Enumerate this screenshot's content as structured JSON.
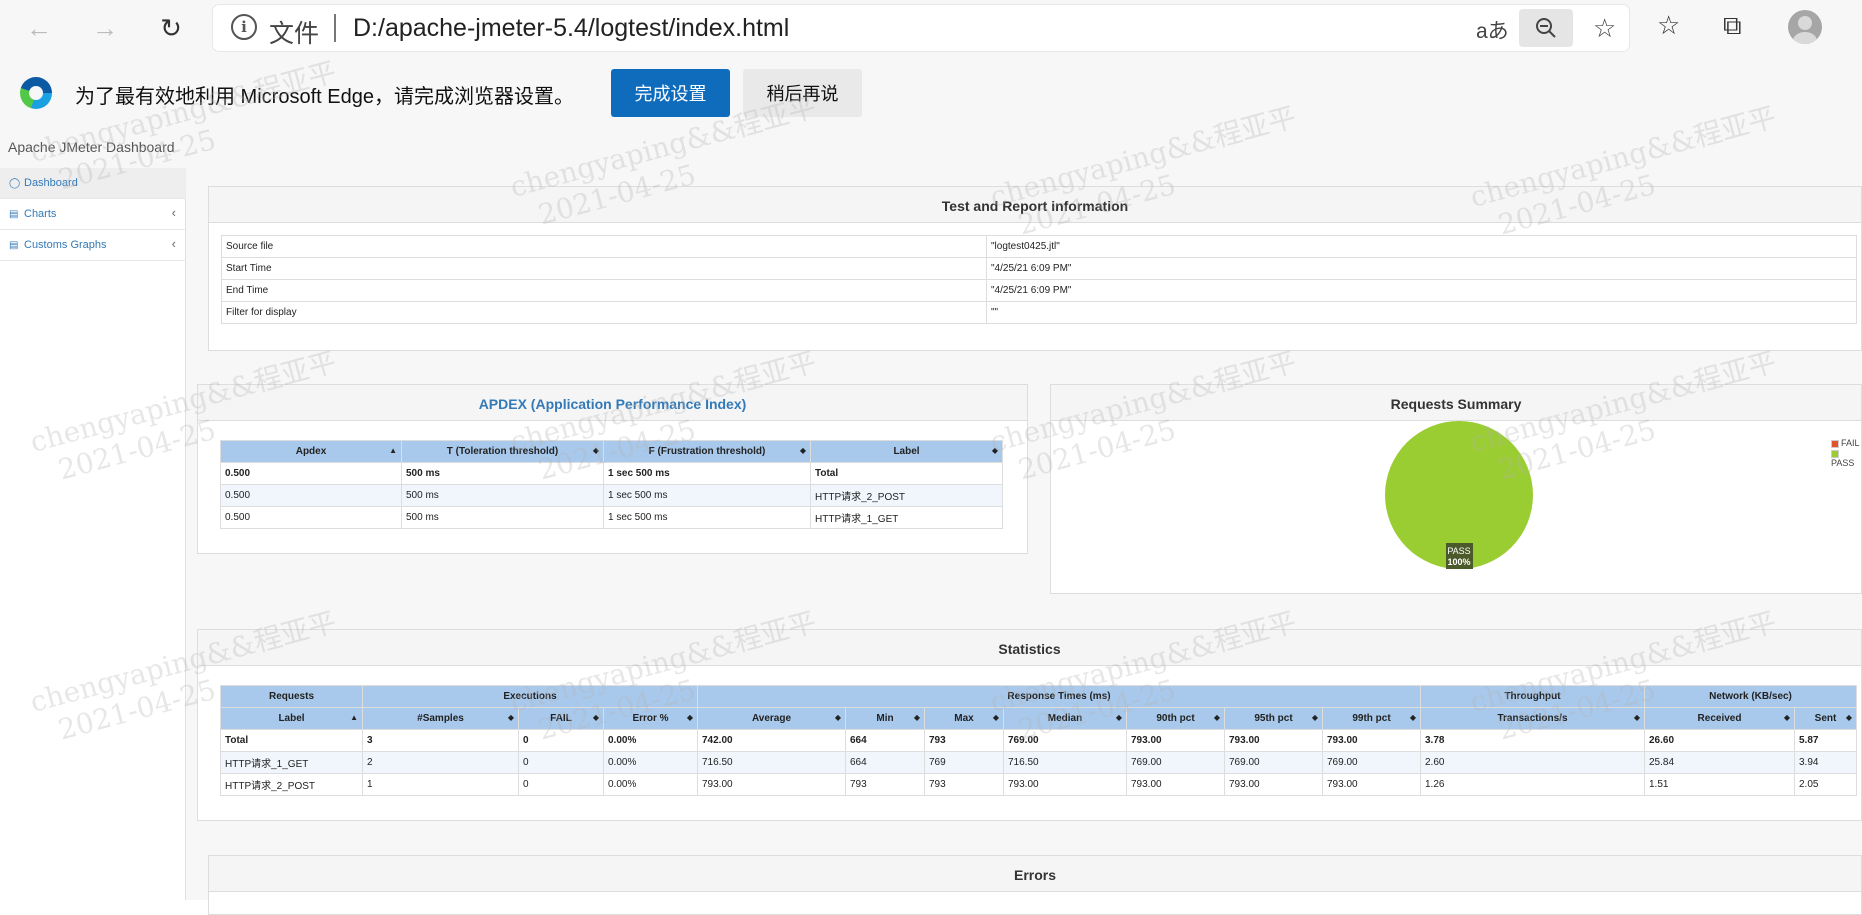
{
  "browser": {
    "scheme_label": "文件",
    "url": "D:/apache-jmeter-5.4/logtest/index.html",
    "read_aloud": "aあ"
  },
  "infobar": {
    "message": "为了最有效地利用 Microsoft Edge，请完成浏览器设置。",
    "primary_button": "完成设置",
    "secondary_button": "稍后再说"
  },
  "app": {
    "brand": "Apache JMeter Dashboard"
  },
  "sidebar": {
    "items": [
      {
        "label": "Dashboard"
      },
      {
        "label": "Charts"
      },
      {
        "label": "Customs Graphs"
      }
    ]
  },
  "test_info": {
    "title": "Test and Report information",
    "rows": [
      {
        "key": "Source file",
        "value": "\"logtest0425.jtl\""
      },
      {
        "key": "Start Time",
        "value": "\"4/25/21 6:09 PM\""
      },
      {
        "key": "End Time",
        "value": "\"4/25/21 6:09 PM\""
      },
      {
        "key": "Filter for display",
        "value": "\"\""
      }
    ]
  },
  "apdex": {
    "title": "APDEX (Application Performance Index)",
    "headers": [
      "Apdex",
      "T (Toleration threshold)",
      "F (Frustration threshold)",
      "Label"
    ],
    "rows": [
      [
        "0.500",
        "500 ms",
        "1 sec 500 ms",
        "Total"
      ],
      [
        "0.500",
        "500 ms",
        "1 sec 500 ms",
        "HTTP请求_2_POST"
      ],
      [
        "0.500",
        "500 ms",
        "1 sec 500 ms",
        "HTTP请求_1_GET"
      ]
    ]
  },
  "requests_summary": {
    "title": "Requests Summary",
    "legend": [
      "FAIL",
      "PASS"
    ],
    "slice_label": "PASS",
    "slice_pct": "100%",
    "colors": {
      "fail": "#e5532b",
      "pass": "#9acd32"
    }
  },
  "chart_data": {
    "type": "pie",
    "title": "Requests Summary",
    "categories": [
      "FAIL",
      "PASS"
    ],
    "values": [
      0,
      100
    ]
  },
  "statistics": {
    "title": "Statistics",
    "group_headers": [
      "Requests",
      "Executions",
      "Response Times (ms)",
      "Throughput",
      "Network (KB/sec)"
    ],
    "headers": [
      "Label",
      "#Samples",
      "FAIL",
      "Error %",
      "Average",
      "Min",
      "Max",
      "Median",
      "90th pct",
      "95th pct",
      "99th pct",
      "Transactions/s",
      "Received",
      "Sent"
    ],
    "rows": [
      [
        "Total",
        "3",
        "0",
        "0.00%",
        "742.00",
        "664",
        "793",
        "769.00",
        "793.00",
        "793.00",
        "793.00",
        "3.78",
        "26.60",
        "5.87"
      ],
      [
        "HTTP请求_1_GET",
        "2",
        "0",
        "0.00%",
        "716.50",
        "664",
        "769",
        "716.50",
        "769.00",
        "769.00",
        "769.00",
        "2.60",
        "25.84",
        "3.94"
      ],
      [
        "HTTP请求_2_POST",
        "1",
        "0",
        "0.00%",
        "793.00",
        "793",
        "793",
        "793.00",
        "793.00",
        "793.00",
        "793.00",
        "1.26",
        "1.51",
        "2.05"
      ]
    ]
  },
  "errors": {
    "title": "Errors"
  },
  "watermark": {
    "line1": "chengyaping&&程亚平",
    "line2": "2021-04-25"
  }
}
